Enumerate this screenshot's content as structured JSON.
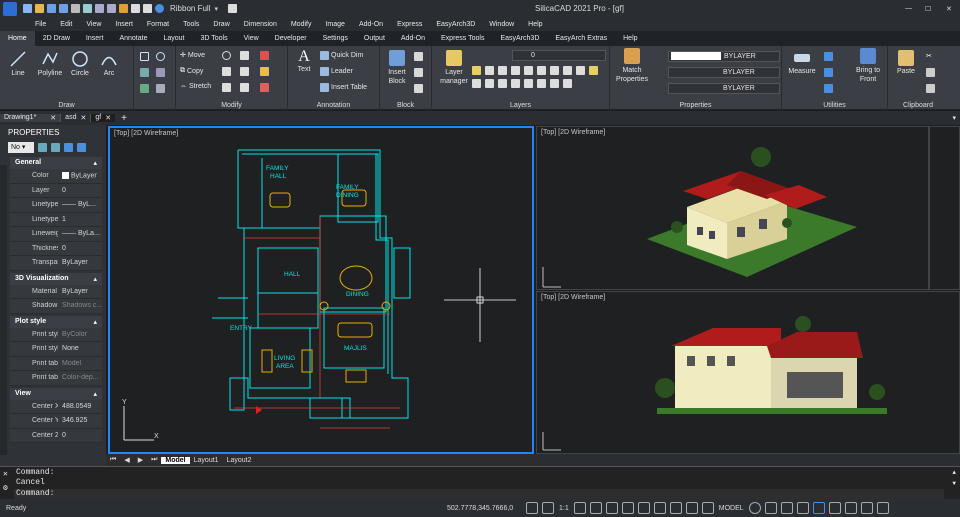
{
  "app": {
    "title": "SilicaCAD 2021 Pro - [gf]",
    "workspace": "Ribbon Full"
  },
  "menu": [
    "File",
    "Edit",
    "View",
    "Insert",
    "Format",
    "Tools",
    "Draw",
    "Dimension",
    "Modify",
    "Image",
    "Add-On",
    "Express",
    "EasyArch3D",
    "Window",
    "Help"
  ],
  "ribbon_tabs": [
    "Home",
    "2D Draw",
    "Insert",
    "Annotate",
    "Layout",
    "3D Tools",
    "View",
    "Developer",
    "Settings",
    "Output",
    "Add-On",
    "Express Tools",
    "EasyArch3D",
    "EasyArch Extras",
    "Help"
  ],
  "ribbon": {
    "draw": {
      "label": "Draw",
      "line": "Line",
      "polyline": "Polyline",
      "circle": "Circle",
      "arc": "Arc"
    },
    "modify": {
      "label": "Modify",
      "move": "Move",
      "copy": "Copy",
      "stretch": "Stretch"
    },
    "annotation": {
      "label": "Annotation",
      "text": "Text",
      "quick_dim": "Quick Dim",
      "leader": "Leader",
      "insert_table": "Insert Table"
    },
    "block": {
      "label": "Block",
      "insert_block": "Insert Block"
    },
    "layers": {
      "label": "Layers",
      "layer_manager": "Layer manager",
      "current_layer": "0"
    },
    "properties": {
      "label": "Properties",
      "match": "Match Properties",
      "color": "BYLAYER",
      "linetype": "BYLAYER",
      "lineweight": "BYLAYER"
    },
    "utilities": {
      "label": "Utilities",
      "measure": "Measure",
      "bring_to_front": "Bring to Front"
    },
    "clipboard": {
      "label": "Clipboard",
      "paste": "Paste"
    }
  },
  "doc_tabs": [
    "Drawing1*",
    "asd",
    "gf"
  ],
  "properties": {
    "header": "PROPERTIES",
    "selection": "No",
    "general": {
      "title": "General",
      "rows": [
        [
          "Color",
          "ByLayer"
        ],
        [
          "Layer",
          "0"
        ],
        [
          "Linetype",
          "—— ByL..."
        ],
        [
          "Linetype s...",
          "1"
        ],
        [
          "Lineweight",
          "—— ByLa..."
        ],
        [
          "Thickness",
          "0"
        ],
        [
          "Transpare...",
          "ByLayer"
        ]
      ]
    },
    "vis3d": {
      "title": "3D Visualization",
      "rows": [
        [
          "Material",
          "ByLayer"
        ],
        [
          "Shadow di...",
          "Shadows c..."
        ]
      ]
    },
    "plot": {
      "title": "Plot style",
      "rows": [
        [
          "Print style",
          "ByColor"
        ],
        [
          "Print style...",
          "None"
        ],
        [
          "Print table...",
          "Model"
        ],
        [
          "Print table...",
          "Color-dep..."
        ]
      ]
    },
    "view": {
      "title": "View",
      "rows": [
        [
          "Center X",
          "488.0549"
        ],
        [
          "Center Y",
          "346.925"
        ],
        [
          "Center Z",
          "0"
        ]
      ]
    }
  },
  "viewports": {
    "main": "[Top] [2D Wireframe]",
    "top_right": "[Top] [2D Wireframe]",
    "bottom_right": "[Top] [2D Wireframe]",
    "room_labels": [
      "FAMILY HALL",
      "FAMILY DINING",
      "HALL",
      "DINING",
      "ENTRY",
      "LIVING AREA",
      "MAJLIS"
    ]
  },
  "layout_tabs": [
    "Model",
    "Layout1",
    "Layout2"
  ],
  "command": {
    "lines": [
      "Command:",
      "Cancel"
    ],
    "prompt": "Command:"
  },
  "status": {
    "ready": "Ready",
    "coords": "502.7778,345.7666,0",
    "scale": "1:1",
    "mode": "MODEL"
  },
  "colors": {
    "accent": "#1f86ff",
    "cad_cyan": "#00e5e5",
    "roof": "#b01c1c",
    "grass": "#3a7a2a"
  }
}
